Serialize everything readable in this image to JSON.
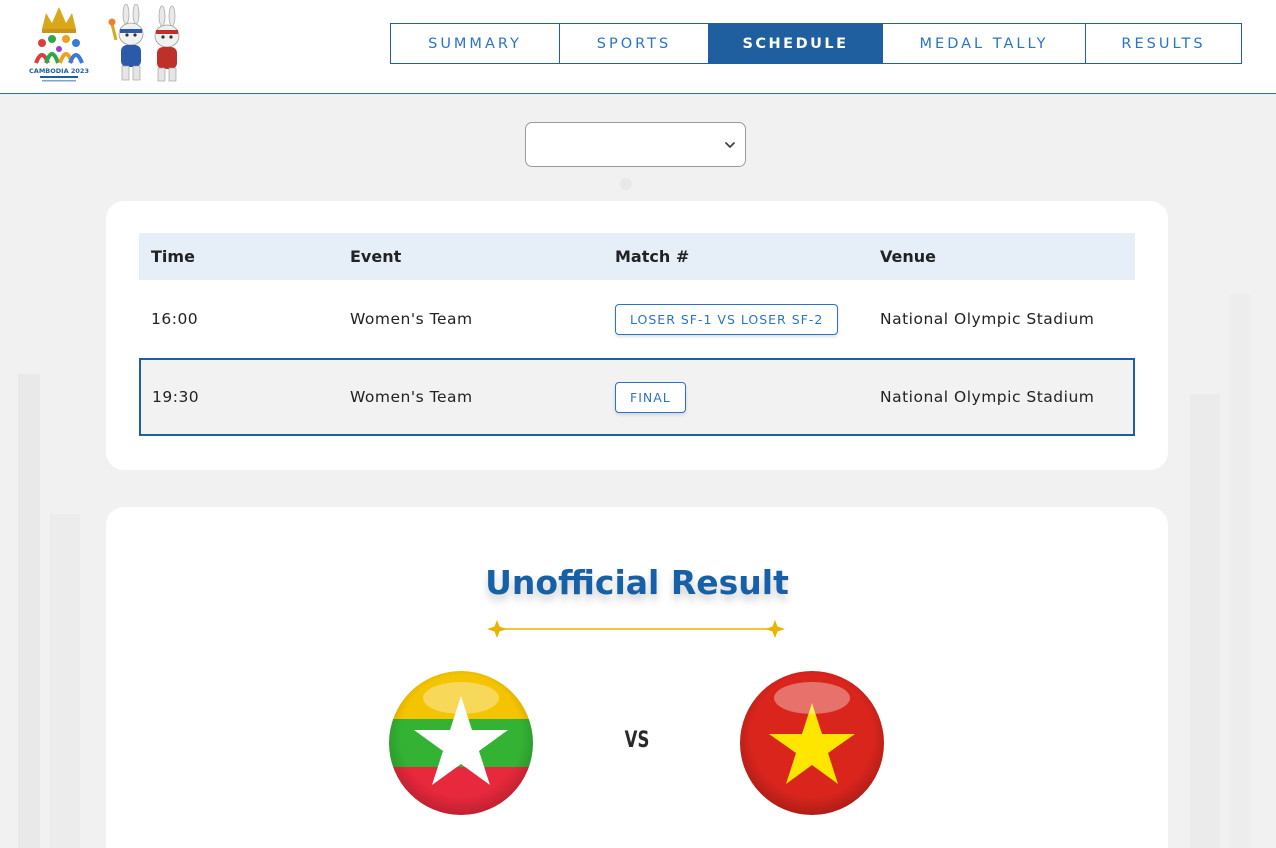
{
  "header": {
    "logo_alt_lines": [
      "CAMBODIA 2023"
    ],
    "nav": [
      {
        "label": "SUMMARY",
        "active": false
      },
      {
        "label": "SPORTS",
        "active": false
      },
      {
        "label": "SCHEDULE",
        "active": true
      },
      {
        "label": "MEDAL TALLY",
        "active": false
      },
      {
        "label": "RESULTS",
        "active": false
      }
    ]
  },
  "filter": {
    "selected": ""
  },
  "schedule": {
    "columns": [
      "Time",
      "Event",
      "Match #",
      "Venue"
    ],
    "rows": [
      {
        "time": "16:00",
        "event": "Women's Team",
        "match": "LOSER SF-1 VS LOSER SF-2",
        "venue": "National Olympic Stadium",
        "selected": false
      },
      {
        "time": "19:30",
        "event": "Women's Team",
        "match": "FINAL",
        "venue": "National Olympic Stadium",
        "selected": true
      }
    ]
  },
  "result": {
    "title": "Unofficial Result",
    "vs_label": "VS",
    "team_left": {
      "flag": "myanmar-flag"
    },
    "team_right": {
      "flag": "vietnam-flag"
    }
  },
  "colors": {
    "primary": "#1f5fa0",
    "link": "#2a74c8",
    "title": "#1660a8",
    "gold": "#e8b400",
    "table_header_bg": "#e6eef8",
    "page_bg": "#f1f1f1"
  }
}
